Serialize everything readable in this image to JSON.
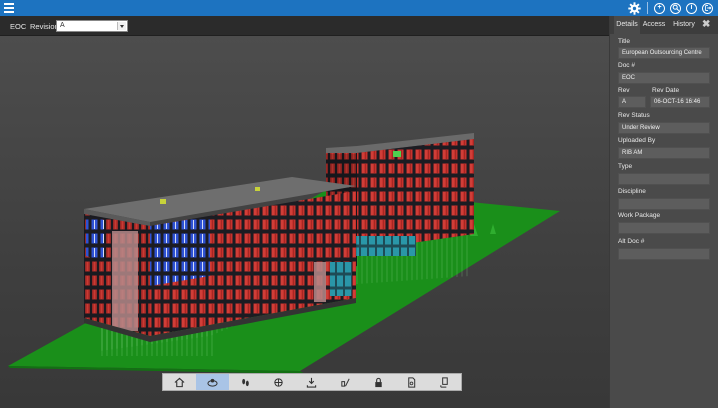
{
  "topbar": {
    "menu_icon": "hamburger-icon",
    "icons": [
      "gear-icon",
      "add-circle-icon",
      "search-circle-icon",
      "info-circle-icon",
      "logout-circle-icon"
    ]
  },
  "docbar": {
    "doc_code": "EOC",
    "revision_label": "Revision",
    "revision_value": "A"
  },
  "nav_tools": [
    "home-icon",
    "orbit-icon",
    "walk-icon",
    "pan-icon",
    "download-icon",
    "markup-icon",
    "lock-icon",
    "document-icon",
    "properties-icon"
  ],
  "panel": {
    "tabs": [
      "Details",
      "Access",
      "History"
    ],
    "active_tab": "Details",
    "fields": {
      "title_label": "Title",
      "title_value": "European Outsourcing Centre",
      "doc_label": "Doc #",
      "doc_value": "EOC",
      "rev_label": "Rev",
      "rev_value": "A",
      "rev_date_label": "Rev Date",
      "rev_date_value": "06-OCT-16 16:46",
      "rev_status_label": "Rev Status",
      "rev_status_value": "Under Review",
      "uploaded_by_label": "Uploaded By",
      "uploaded_by_value": "RIB AM",
      "type_label": "Type",
      "type_value": "",
      "discipline_label": "Discipline",
      "discipline_value": "",
      "work_package_label": "Work Package",
      "work_package_value": "",
      "alt_doc_label": "Alt Doc #",
      "alt_doc_value": ""
    }
  },
  "colors": {
    "topbar": "#1d73c0",
    "ground": "#1a8f1a",
    "facade_red": "#c8322d",
    "frame": "#1c1c22",
    "glass_blue": "#2f52d4",
    "glass_teal": "#2a97a8"
  }
}
